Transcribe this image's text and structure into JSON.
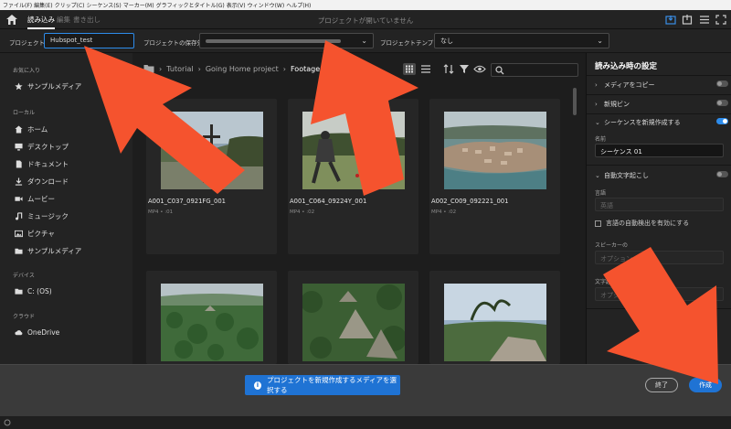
{
  "menubar": {
    "items": [
      "ファイル(F)",
      "編集(E)",
      "クリップ(C)",
      "シーケンス(S)",
      "マーカー(M)",
      "グラフィックとタイトル(G)",
      "表示(V)",
      "ウィンドウ(W)",
      "ヘルプ(H)"
    ]
  },
  "topbar": {
    "tabs": [
      "読み込み",
      "編集",
      "書き出し"
    ],
    "status": "プロジェクトが開いていません"
  },
  "project": {
    "name_label": "プロジェクト名",
    "name_value": "Hubspot_test",
    "location_label": "プロジェクトの保存先",
    "template_label": "プロジェクトテンプレート",
    "template_value": "なし"
  },
  "sidebar": {
    "favorites_label": "お気に入り",
    "favorites": [
      "サンプルメディア"
    ],
    "local_label": "ローカル",
    "local": [
      "ホーム",
      "デスクトップ",
      "ドキュメント",
      "ダウンロード",
      "ムービー",
      "ミュージック",
      "ピクチャ",
      "サンプルメディア"
    ],
    "devices_label": "デバイス",
    "devices": [
      "C: (OS)"
    ],
    "cloud_label": "クラウド",
    "cloud": [
      "OneDrive"
    ]
  },
  "breadcrumb": [
    "Tutorial",
    "Going Home project",
    "Footage"
  ],
  "clips": [
    {
      "name": "A001_C037_0921FG_001",
      "meta": "MP4 • :01"
    },
    {
      "name": "A001_C064_09224Y_001",
      "meta": "MP4 • :02"
    },
    {
      "name": "A002_C009_092221_001",
      "meta": "MP4 • :02"
    },
    {
      "name": "",
      "meta": ""
    },
    {
      "name": "",
      "meta": ""
    },
    {
      "name": "",
      "meta": ""
    }
  ],
  "settings": {
    "title": "読み込み時の設定",
    "copy_media": "メディアをコピー",
    "new_bin": "新規ビン",
    "create_sequence": "シーケンスを新規作成する",
    "name_label": "名前",
    "sequence_name": "シーケンス 01",
    "auto_caption": "自動文字起こし",
    "language_label": "言語",
    "language_value": "英語",
    "auto_detect": "言語の自動検出を有効にする",
    "speaker_label": "スピーカーの",
    "speaker_value": "オプション",
    "caption_label": "文字起こしの精",
    "caption_value": "オプションを"
  },
  "bottom": {
    "info": "プロジェクトを新規作成するメディアを選択する",
    "exit": "終了",
    "create": "作成"
  },
  "colors": {
    "accent": "#1f73d4",
    "arrow": "#f5532e"
  }
}
